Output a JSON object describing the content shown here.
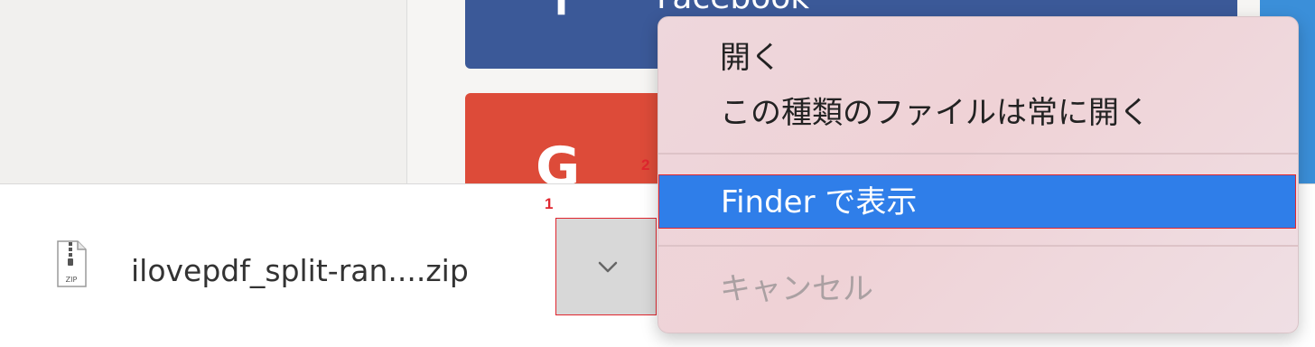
{
  "background_page": {
    "facebook_label": "Facebook",
    "facebook_icon": "f",
    "google_icon": "G"
  },
  "download_bar": {
    "file_icon": "zip-file-icon",
    "file_icon_text": "ZIP",
    "filename": "ilovepdf_split-ran....zip",
    "chevron_icon": "chevron-down-icon"
  },
  "context_menu": {
    "items": [
      {
        "label": "開く",
        "state": "normal"
      },
      {
        "label": "この種類のファイルは常に開く",
        "state": "normal"
      },
      {
        "label": "Finder で表示",
        "state": "highlighted"
      },
      {
        "label": "キャンセル",
        "state": "disabled"
      }
    ]
  },
  "annotations": {
    "step1": "1",
    "step2": "2"
  },
  "colors": {
    "accent_highlight": "#2f7ee9",
    "annotation_red": "#e0262f",
    "facebook_blue": "#3b5998",
    "google_red": "#dd4b39"
  }
}
